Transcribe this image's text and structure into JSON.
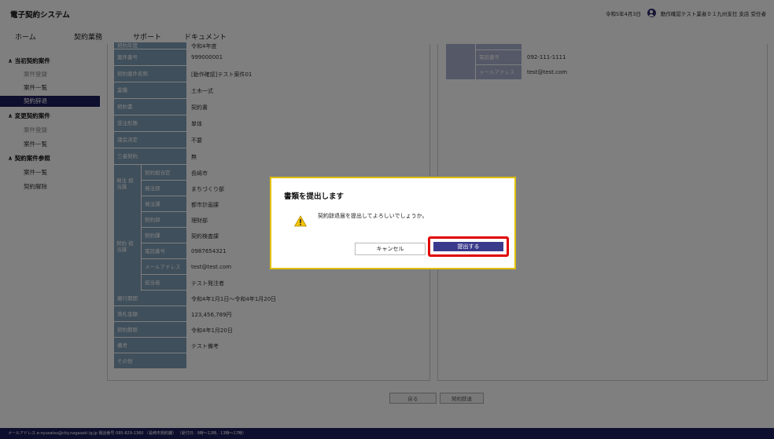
{
  "app": {
    "title": "電子契約システム"
  },
  "header": {
    "date": "令和5年4月3日",
    "user": "動作確認テスト業者０１九州支社 支店 受任者"
  },
  "tabs": [
    "ホーム",
    "契約業務",
    "サポート",
    "ドキュメント"
  ],
  "sidebar": {
    "initial": {
      "heading": "当初契約案件",
      "items": [
        "案件登録",
        "案件一覧",
        "契約辞退"
      ]
    },
    "change": {
      "heading": "変更契約案件",
      "items": [
        "案件登録",
        "案件一覧"
      ]
    },
    "reference": {
      "heading": "契約案件参照",
      "items": [
        "案件一覧",
        "契約解除"
      ]
    }
  },
  "left_rows": [
    {
      "label": "契約年度",
      "value": "令和4年度"
    },
    {
      "label": "案件番号",
      "value": "999000001"
    },
    {
      "label": "契約案件名称",
      "value": "[動作確認]テスト案件01"
    },
    {
      "label": "業種",
      "value": "土木一式"
    },
    {
      "label": "契約書",
      "value": "契約書"
    },
    {
      "label": "受注形態",
      "value": "単体"
    },
    {
      "label": "議会決定",
      "value": "不要"
    },
    {
      "label": "三者契約",
      "value": "無"
    }
  ],
  "order_group": {
    "label": "発注 担当課",
    "rows": [
      {
        "label": "契約担当官",
        "value": "長崎市"
      },
      {
        "label": "発注部",
        "value": "まちづくり部"
      },
      {
        "label": "発注課",
        "value": "都市計画課"
      }
    ]
  },
  "contract_group": {
    "label": "契約 担当課",
    "rows": [
      {
        "label": "契約部",
        "value": "理財部"
      },
      {
        "label": "契約課",
        "value": "契約検査課"
      },
      {
        "label": "電話番号",
        "value": "0987654321"
      },
      {
        "label": "メールアドレス",
        "value": "test@test.com"
      },
      {
        "label": "担当者",
        "value": "テスト発注者"
      }
    ]
  },
  "left_rows2": [
    {
      "label": "履行期間",
      "value": "令和4年1月1日～令和4年1月20日"
    },
    {
      "label": "落札金額",
      "value": "123,456,789円"
    },
    {
      "label": "契約期限",
      "value": "令和4年1月20日"
    },
    {
      "label": "備考",
      "value": "テスト備考"
    },
    {
      "label": "その他",
      "value": ""
    }
  ],
  "right_rows": [
    {
      "label": "電話番号",
      "value": "092-111-1111"
    },
    {
      "label": "メールアドレス",
      "value": "test@test.com"
    }
  ],
  "bottom_buttons": {
    "back": "戻る",
    "decline": "契約辞退"
  },
  "footer": {
    "text": "メールアドレス e-nyusatsu@city.nagasaki.lg.jp    電話番号 095-829-1360  （長崎市契約課）  （受付日：9時〜12時、13時〜17時）"
  },
  "dialog": {
    "title": "書類を提出します",
    "message": "契約辞退届を提出してよろしいでしょうか。",
    "cancel": "キャンセル",
    "submit": "提出する"
  }
}
